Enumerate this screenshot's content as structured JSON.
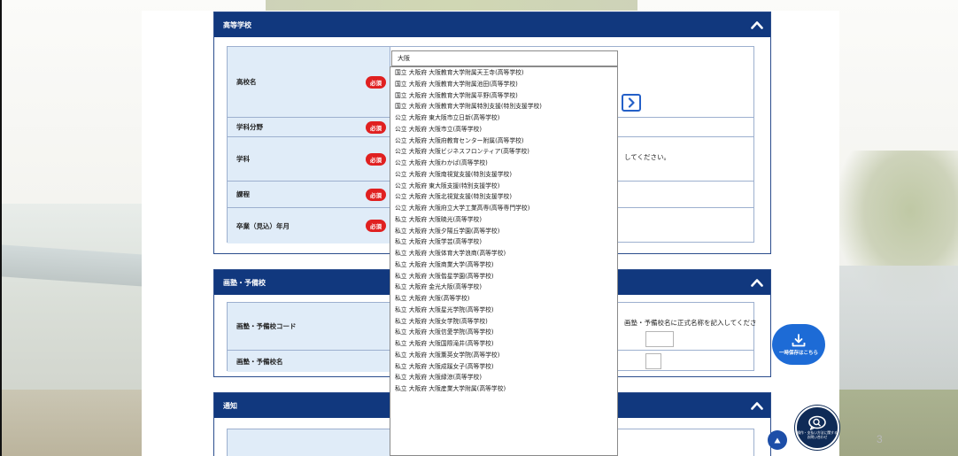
{
  "sections": {
    "high_school": {
      "title": "高等学校",
      "rows": [
        {
          "label": "高校名",
          "required": "必須"
        },
        {
          "label": "学科分野",
          "required": "必須"
        },
        {
          "label": "学科",
          "required": "必須"
        },
        {
          "label": "課程",
          "required": "必須"
        },
        {
          "label": "卒業（見込）年月",
          "required": "必須"
        }
      ],
      "school_search_value": "大阪",
      "dept_note": "してください。"
    },
    "cram_school": {
      "title": "画塾・予備校",
      "rows": [
        {
          "label": "画塾・予備校コード"
        },
        {
          "label": "画塾・予備校名"
        }
      ],
      "code_note": "画塾・予備校名に正式名称を記入してくださ"
    },
    "notification": {
      "title": "通知"
    }
  },
  "autocomplete": {
    "items": [
      "国立 大阪府 大阪教育大学附属天王寺(高等学校)",
      "国立 大阪府 大阪教育大学附属池田(高等学校)",
      "国立 大阪府 大阪教育大学附属平野(高等学校)",
      "国立 大阪府 大阪教育大学附属特別支援(特別支援学校)",
      "公立 大阪府 東大阪市立日新(高等学校)",
      "公立 大阪府 大阪市立(高等学校)",
      "公立 大阪府 大阪府教育センター附属(高等学校)",
      "公立 大阪府 大阪ビジネスフロンティア(高等学校)",
      "公立 大阪府 大阪わかば(高等学校)",
      "公立 大阪府 大阪南視覚支援(特別支援学校)",
      "公立 大阪府 東大阪支援(特別支援学校)",
      "公立 大阪府 大阪北視覚支援(特別支援学校)",
      "公立 大阪府 大阪府立大学工業高専(高等専門学校)",
      "私立 大阪府 大阪暁光(高等学校)",
      "私立 大阪府 大阪夕陽丘学園(高等学校)",
      "私立 大阪府 大阪学芸(高等学校)",
      "私立 大阪府 大阪体育大学浪商(高等学校)",
      "私立 大阪府 大阪商業大学(高等学校)",
      "私立 大阪府 大阪偕星学園(高等学校)",
      "私立 大阪府 金光大阪(高等学校)",
      "私立 大阪府 大阪(高等学校)",
      "私立 大阪府 大阪星光学院(高等学校)",
      "私立 大阪府 大阪女学院(高等学校)",
      "私立 大阪府 大阪信愛学院(高等学校)",
      "私立 大阪府 大阪国際滝井(高等学校)",
      "私立 大阪府 大阪薫英女学院(高等学校)",
      "私立 大阪府 大阪成蹊女子(高等学校)",
      "私立 大阪府 大阪緑涼(高等学校)",
      "私立 大阪府 大阪産業大学附属(高等学校)"
    ]
  },
  "floating": {
    "save_label": "一時保存はこちら",
    "chat_label": "操作・支払い方法に関するお問い合わせ"
  },
  "page_number": "3",
  "colors": {
    "header_bg": "#11387e",
    "label_bg": "#e0ecf8",
    "required_badge": "#e02020",
    "save_button": "#1d6bd6",
    "chat_button": "#0f2b57"
  }
}
